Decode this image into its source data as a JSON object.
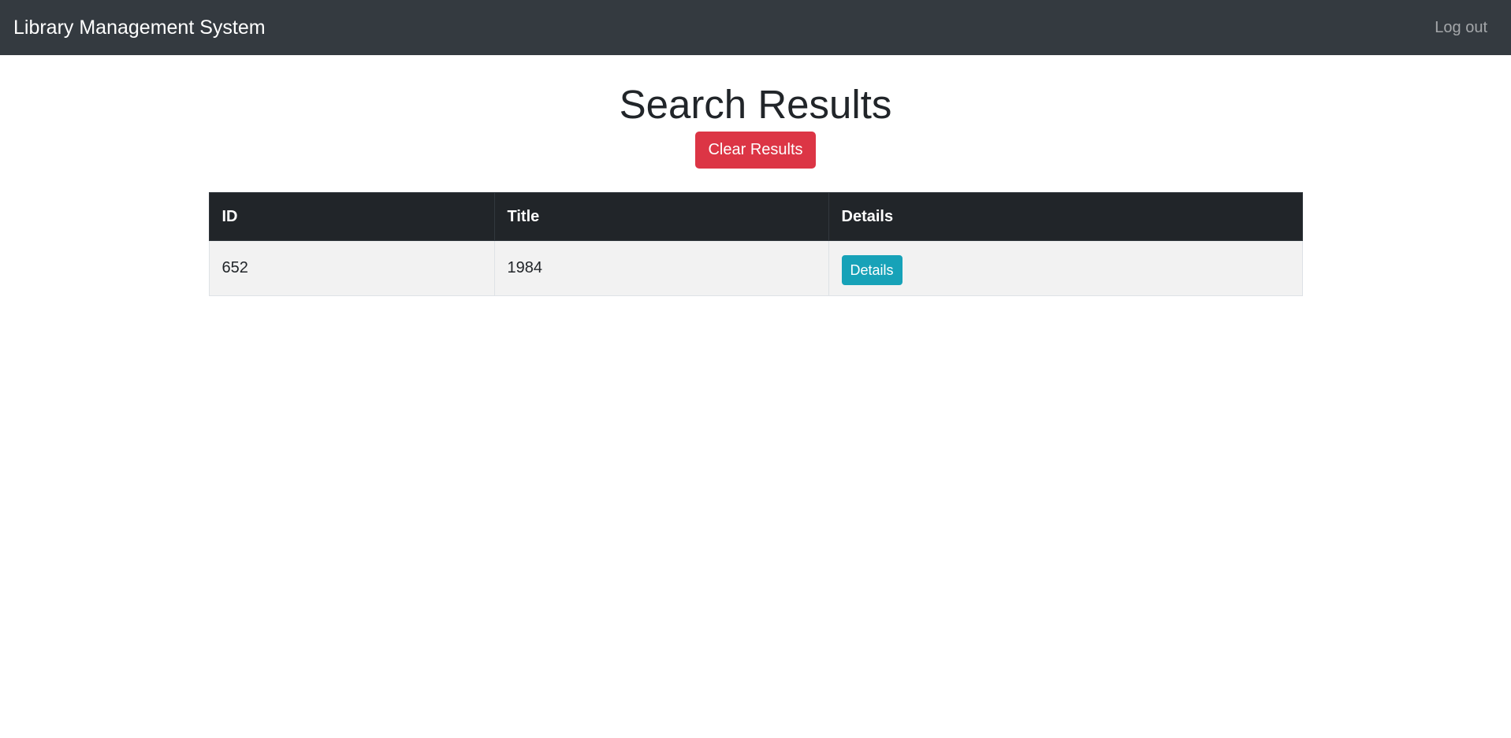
{
  "navbar": {
    "brand": "Library Management System",
    "logout_label": "Log out"
  },
  "main": {
    "title": "Search Results",
    "clear_button_label": "Clear Results"
  },
  "table": {
    "columns": [
      "ID",
      "Title",
      "Details"
    ],
    "rows": [
      {
        "id": "652",
        "title": "1984",
        "details_label": "Details"
      }
    ]
  },
  "colors": {
    "navbar_bg": "#343a40",
    "table_header_bg": "#212529",
    "danger": "#dc3545",
    "info": "#17a2b8"
  }
}
